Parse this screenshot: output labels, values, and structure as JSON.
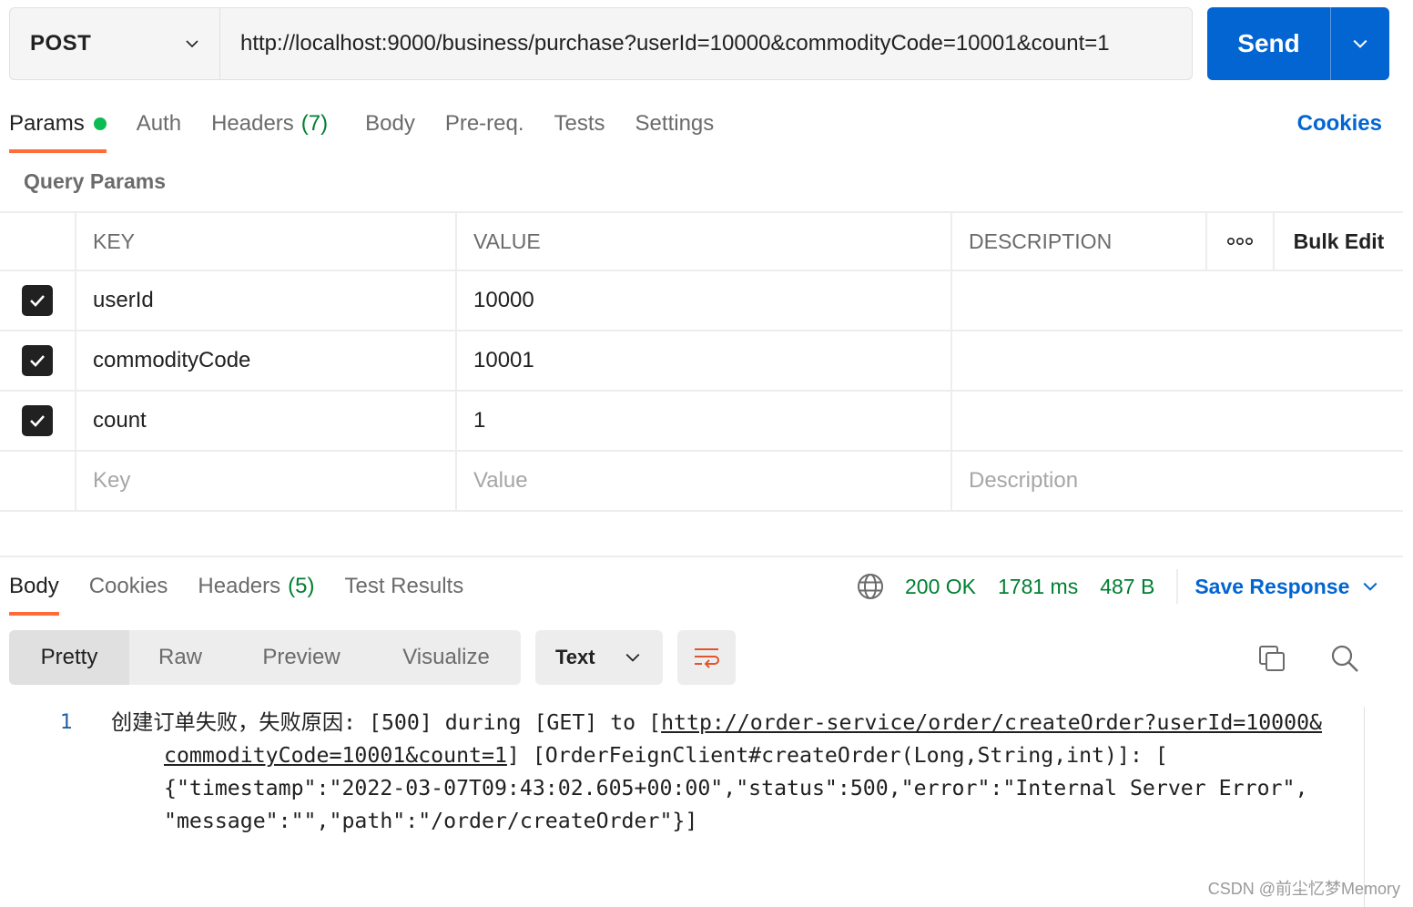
{
  "request": {
    "method": "POST",
    "url": "http://localhost:9000/business/purchase?userId=10000&commodityCode=10001&count=1",
    "send_label": "Send"
  },
  "request_tabs": {
    "params": "Params",
    "auth": "Auth",
    "headers": "Headers",
    "headers_count": "(7)",
    "body": "Body",
    "prereq": "Pre-req.",
    "tests": "Tests",
    "settings": "Settings",
    "cookies": "Cookies"
  },
  "query_params": {
    "title": "Query Params",
    "columns": {
      "key": "KEY",
      "value": "VALUE",
      "description": "DESCRIPTION",
      "more": "ooo",
      "bulk_edit": "Bulk Edit"
    },
    "rows": [
      {
        "key": "userId",
        "value": "10000",
        "description": "",
        "checked": true
      },
      {
        "key": "commodityCode",
        "value": "10001",
        "description": "",
        "checked": true
      },
      {
        "key": "count",
        "value": "1",
        "description": "",
        "checked": true
      }
    ],
    "placeholders": {
      "key": "Key",
      "value": "Value",
      "description": "Description"
    }
  },
  "response_tabs": {
    "body": "Body",
    "cookies": "Cookies",
    "headers": "Headers",
    "headers_count": "(5)",
    "test_results": "Test Results"
  },
  "response_status": {
    "status": "200 OK",
    "time": "1781 ms",
    "size": "487 B",
    "save_response": "Save Response"
  },
  "response_view": {
    "modes": [
      "Pretty",
      "Raw",
      "Preview",
      "Visualize"
    ],
    "active_mode": "Pretty",
    "format": "Text"
  },
  "response_body": {
    "line_number": "1",
    "line1_prefix": "创建订单失败，失败原因: [500] during [GET] to [",
    "link_part1": "http://order-service/order/createOrder?userId=10000&",
    "link_part2": "commodityCode=10001&count=1",
    "line2_suffix": "] [OrderFeignClient#createOrder(Long,String,int)]: [",
    "line3": "{\"timestamp\":\"2022-03-07T09:43:02.605+00:00\",\"status\":500,\"error\":\"Internal Server Error\",",
    "line4": "\"message\":\"\",\"path\":\"/order/createOrder\"}]"
  },
  "colors": {
    "accent_orange": "#ff6c37",
    "primary_blue": "#0265d2",
    "status_green": "#007f31",
    "dot_green": "#0cbb52"
  },
  "watermark": "CSDN @前尘忆梦Memory"
}
